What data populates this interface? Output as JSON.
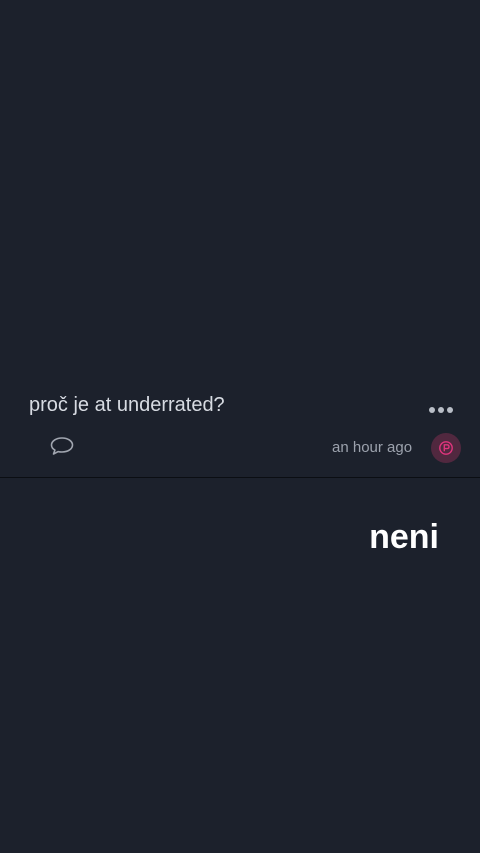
{
  "post": {
    "text": "proč je at underrated?",
    "timestamp": "an hour ago",
    "more_icon": "more-horizontal-icon",
    "comment_icon": "speech-bubble-icon",
    "avatar_icon": "profile-badge-icon"
  },
  "reply": {
    "text": "neni"
  },
  "colors": {
    "background": "#1c212c",
    "post_text": "#d7dbe2",
    "muted_text": "#9ca2ad",
    "avatar_bg": "#51283f",
    "avatar_accent": "#e0357d",
    "reply_text": "#ffffff"
  }
}
